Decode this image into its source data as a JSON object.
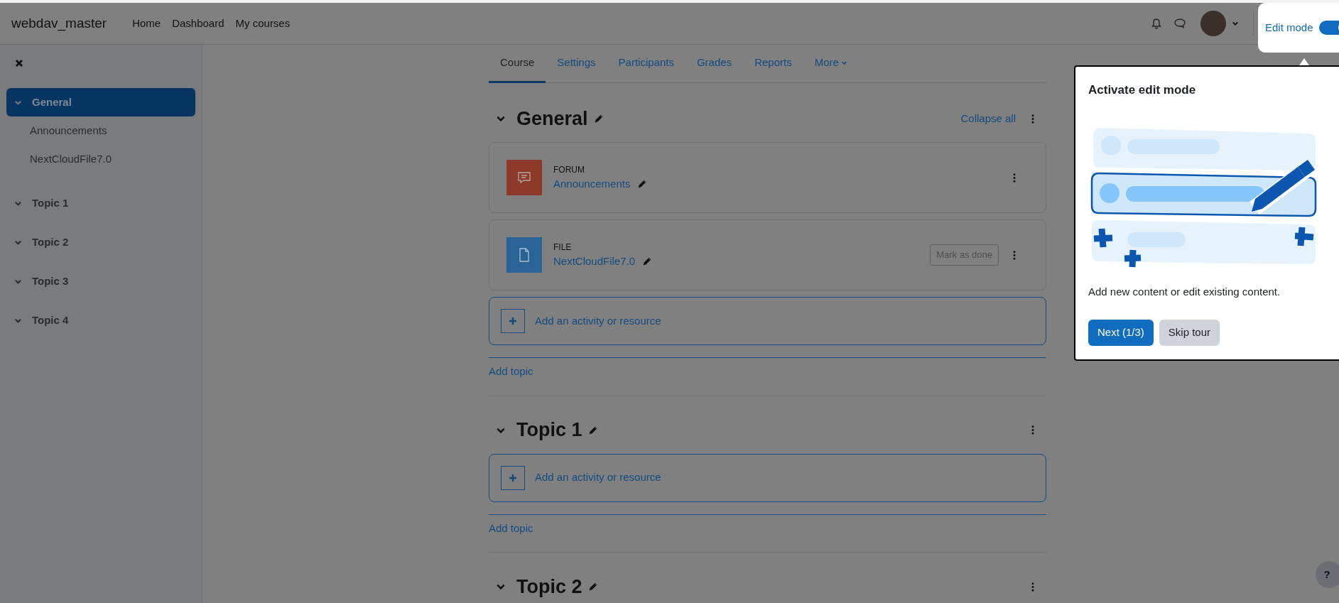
{
  "site_name": "webdav_master",
  "nav": [
    {
      "label": "Home"
    },
    {
      "label": "Dashboard"
    },
    {
      "label": "My courses"
    }
  ],
  "edit_mode": {
    "label": "Edit mode",
    "on": true
  },
  "sidebar": {
    "items": [
      {
        "label": "General",
        "selected": true,
        "children": [
          {
            "label": "Announcements"
          },
          {
            "label": "NextCloudFile7.0"
          }
        ]
      },
      {
        "label": "Topic 1",
        "selected": false
      },
      {
        "label": "Topic 2",
        "selected": false
      },
      {
        "label": "Topic 3",
        "selected": false
      },
      {
        "label": "Topic 4",
        "selected": false
      }
    ]
  },
  "tabs": [
    {
      "label": "Course",
      "selected": true
    },
    {
      "label": "Settings",
      "selected": false
    },
    {
      "label": "Participants",
      "selected": false
    },
    {
      "label": "Grades",
      "selected": false
    },
    {
      "label": "Reports",
      "selected": false
    },
    {
      "label": "More",
      "selected": false,
      "kind": "dropdown"
    }
  ],
  "sections": [
    {
      "title": "General",
      "collapse_all": "Collapse all",
      "items": [
        {
          "kind": "forum",
          "type": "FORUM",
          "name": "Announcements"
        },
        {
          "kind": "file",
          "type": "FILE",
          "name": "NextCloudFile7.0",
          "mark_done": "Mark as done"
        }
      ],
      "add_activity": "Add an activity or resource",
      "add_topic": "Add topic"
    },
    {
      "title": "Topic 1",
      "add_activity": "Add an activity or resource",
      "add_topic": "Add topic"
    },
    {
      "title": "Topic 2"
    }
  ],
  "tour": {
    "title": "Activate edit mode",
    "text": "Add new content or edit existing content.",
    "buttons": [
      {
        "label": "Next (1/3)",
        "kind": "primary"
      },
      {
        "label": "Skip tour",
        "kind": "secondary"
      }
    ]
  },
  "help": "?"
}
